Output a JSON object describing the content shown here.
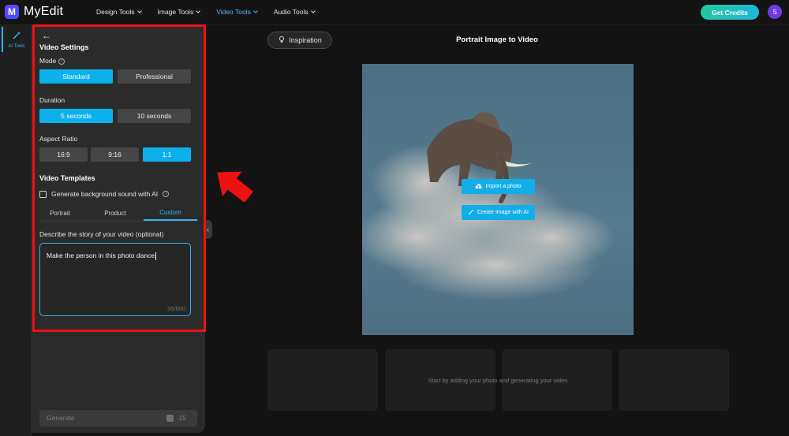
{
  "app": {
    "name": "MyEdit",
    "logo_letter": "M"
  },
  "nav": {
    "items": [
      "Design Tools",
      "Image Tools",
      "Video Tools",
      "Audio Tools"
    ],
    "active_index": 2
  },
  "header": {
    "credits_label": "Get Credits",
    "avatar_initial": "S"
  },
  "rail": {
    "ai_tools_label": "AI Tools"
  },
  "panel": {
    "section_title": "Video Settings",
    "mode_label": "Mode",
    "mode_options": [
      "Standard",
      "Professional"
    ],
    "duration_label": "Duration",
    "duration_options": [
      "5 seconds",
      "10 seconds"
    ],
    "aspect_label": "Aspect Ratio",
    "aspect_options": [
      "16:9",
      "9:16",
      "1:1"
    ],
    "templates_title": "Video Templates",
    "bg_sound_label": "Generate background sound with AI",
    "template_tabs": [
      "Portrait",
      "Product",
      "Custom"
    ],
    "story_label": "Describe the story of your video (optional)",
    "story_value": "Make the person in this photo dance",
    "story_count": "35/800",
    "generate_label": "Generate",
    "generate_cost": "-15"
  },
  "main": {
    "inspiration_label": "Inspiration",
    "title": "Portrait Image to Video",
    "import_label": "Import a photo",
    "create_label": "Create Image with AI",
    "hint": "Start by adding your photo and generating your video"
  },
  "colors": {
    "accent": "#0cb1ec",
    "annotation": "#ee1111",
    "credits_start": "#25c7a0",
    "credits_end": "#1fb6d8"
  }
}
